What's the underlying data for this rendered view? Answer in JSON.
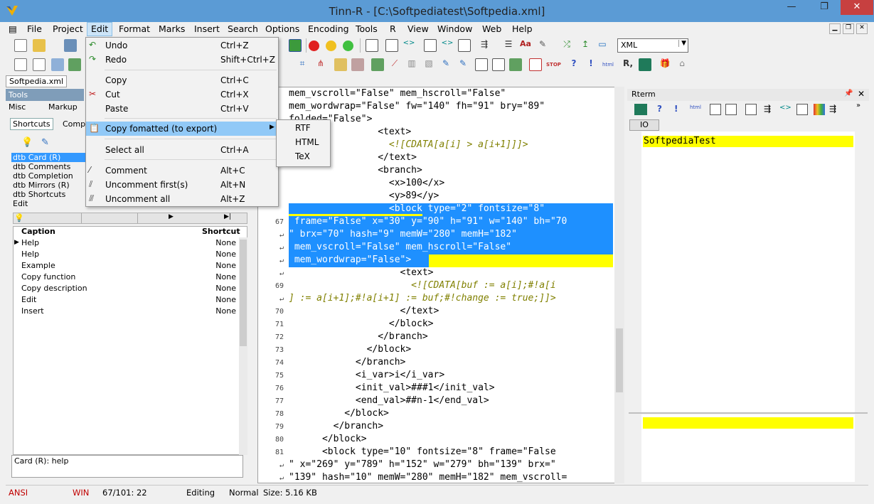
{
  "window": {
    "title": "Tinn-R - [C:\\Softpediatest\\Softpedia.xml]",
    "min": "—",
    "max": "❐",
    "close": "✕"
  },
  "menu": [
    "File",
    "Project",
    "Edit",
    "Format",
    "Marks",
    "Insert",
    "Search",
    "Options",
    "Encoding",
    "Tools",
    "R",
    "View",
    "Window",
    "Web",
    "Help"
  ],
  "toolbar": {
    "syntax_select": "XML"
  },
  "file_tab": "Softpedia.xml",
  "tools": {
    "title": "Tools",
    "tabs": [
      "Misc",
      "Markup"
    ],
    "subtabs": [
      "Shortcuts",
      "Compl"
    ],
    "list": [
      "dtb Card (R)",
      "dtb Comments",
      "dtb Completion",
      "dtb Mirrors (R)",
      "dtb Shortcuts",
      "Edit"
    ],
    "columns": {
      "caption": "Caption",
      "shortcut": "Shortcut"
    },
    "rows": [
      {
        "caption": "Help",
        "shortcut": "None"
      },
      {
        "caption": "Help",
        "shortcut": "None"
      },
      {
        "caption": "Example",
        "shortcut": "None"
      },
      {
        "caption": "Copy function",
        "shortcut": "None"
      },
      {
        "caption": "Copy description",
        "shortcut": "None"
      },
      {
        "caption": "Edit",
        "shortcut": "None"
      },
      {
        "caption": "Insert",
        "shortcut": "None"
      }
    ],
    "memo": "Card (R): help"
  },
  "edit_menu": {
    "undo": {
      "label": "Undo",
      "shortcut": "Ctrl+Z"
    },
    "redo": {
      "label": "Redo",
      "shortcut": "Shift+Ctrl+Z"
    },
    "copy": {
      "label": "Copy",
      "shortcut": "Ctrl+C"
    },
    "cut": {
      "label": "Cut",
      "shortcut": "Ctrl+X"
    },
    "paste": {
      "label": "Paste",
      "shortcut": "Ctrl+V"
    },
    "copy_formatted": {
      "label": "Copy fomatted (to export)"
    },
    "select_all": {
      "label": "Select all",
      "shortcut": "Ctrl+A"
    },
    "comment": {
      "label": "Comment",
      "shortcut": "Alt+C"
    },
    "uncomment_first": {
      "label": "Uncomment first(s)",
      "shortcut": "Alt+N"
    },
    "uncomment_all": {
      "label": "Uncomment all",
      "shortcut": "Alt+Z"
    }
  },
  "export_submenu": [
    "RTF",
    "HTML",
    "TeX"
  ],
  "editor": {
    "gutter": [
      "",
      "",
      "",
      "",
      "",
      "",
      "",
      "",
      "",
      "",
      "67",
      "↵",
      "↵",
      "↵",
      "↵",
      "69",
      "↵",
      "70",
      "71",
      "72",
      "73",
      "74",
      "75",
      "76",
      "77",
      "78",
      "79",
      "80",
      "81",
      "↵",
      "↵"
    ],
    "lines": [
      "mem_vscroll=\"False\" mem_hscroll=\"False\"",
      "mem_wordwrap=\"False\" fw=\"140\" fh=\"91\" bry=\"89\"",
      "folded=\"False\">",
      "                <text>",
      "                  <![CDATA[a[i] > a[i+1]]]>",
      "                </text>",
      "                <branch>",
      "                  <x>100</x>",
      "                  <y>89</y>",
      "",
      "",
      "",
      "",
      "",
      "",
      "                    <text>",
      "                      <![CDATA[buf := a[i];#!a[i",
      "] := a[i+1];#!a[i+1] := buf;#!change := true;]]>",
      "                    </text>",
      "                  </block>",
      "                </branch>",
      "              </block>",
      "            </branch>",
      "            <i_var>i</i_var>",
      "            <init_val>###1</init_val>",
      "            <end_val>##n-1</end_val>",
      "          </block>",
      "        </branch>",
      "      </block>",
      "      <block type=\"10\" fontsize=\"8\" frame=\"False",
      "\" x=\"269\" y=\"789\" h=\"152\" w=\"279\" bh=\"139\" brx=\"",
      "\"139\" hash=\"10\" memW=\"280\" memH=\"182\" mem_vscroll="
    ],
    "highlight": [
      "                  <block type=\"2\" fontsize=\"8\"",
      " frame=\"False\" x=\"30\" y=\"90\" h=\"91\" w=\"140\" bh=\"70",
      "\" brx=\"70\" hash=\"9\" memW=\"280\" memH=\"182\"",
      " mem_vscroll=\"False\" mem_hscroll=\"False\"",
      " mem_wordwrap=\"False\">"
    ]
  },
  "rterm": {
    "title": "Rterm",
    "tab": "IO",
    "output": "SoftpediaTest"
  },
  "status": {
    "encoding": "ANSI",
    "eol": "WIN",
    "position": "67/101: 22",
    "mode": "Editing",
    "style": "Normal",
    "size": "Size: 5.16 KB"
  }
}
